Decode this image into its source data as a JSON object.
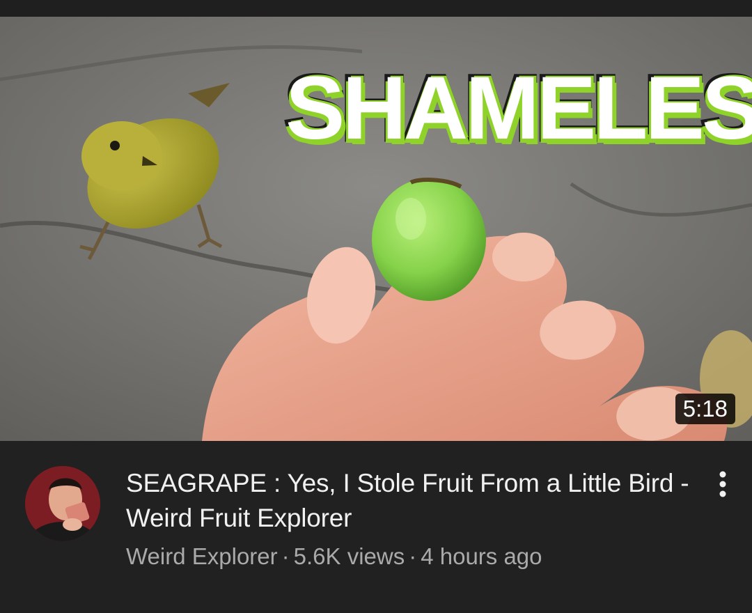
{
  "thumbnail": {
    "overlay_text": "SHAMELESS",
    "duration": "5:18",
    "accent_color": "#8fd22a"
  },
  "video": {
    "title": "SEAGRAPE : Yes, I Stole Fruit From a Little Bird - Weird Fruit Explorer",
    "channel": "Weird Explorer",
    "separator": "·",
    "views": "5.6K views",
    "age": "4 hours ago"
  },
  "icons": {
    "menu": "more-vertical-icon"
  },
  "colors": {
    "background": "#212121",
    "title_text": "#f1f1f1",
    "secondary_text": "#aaaaaa"
  }
}
